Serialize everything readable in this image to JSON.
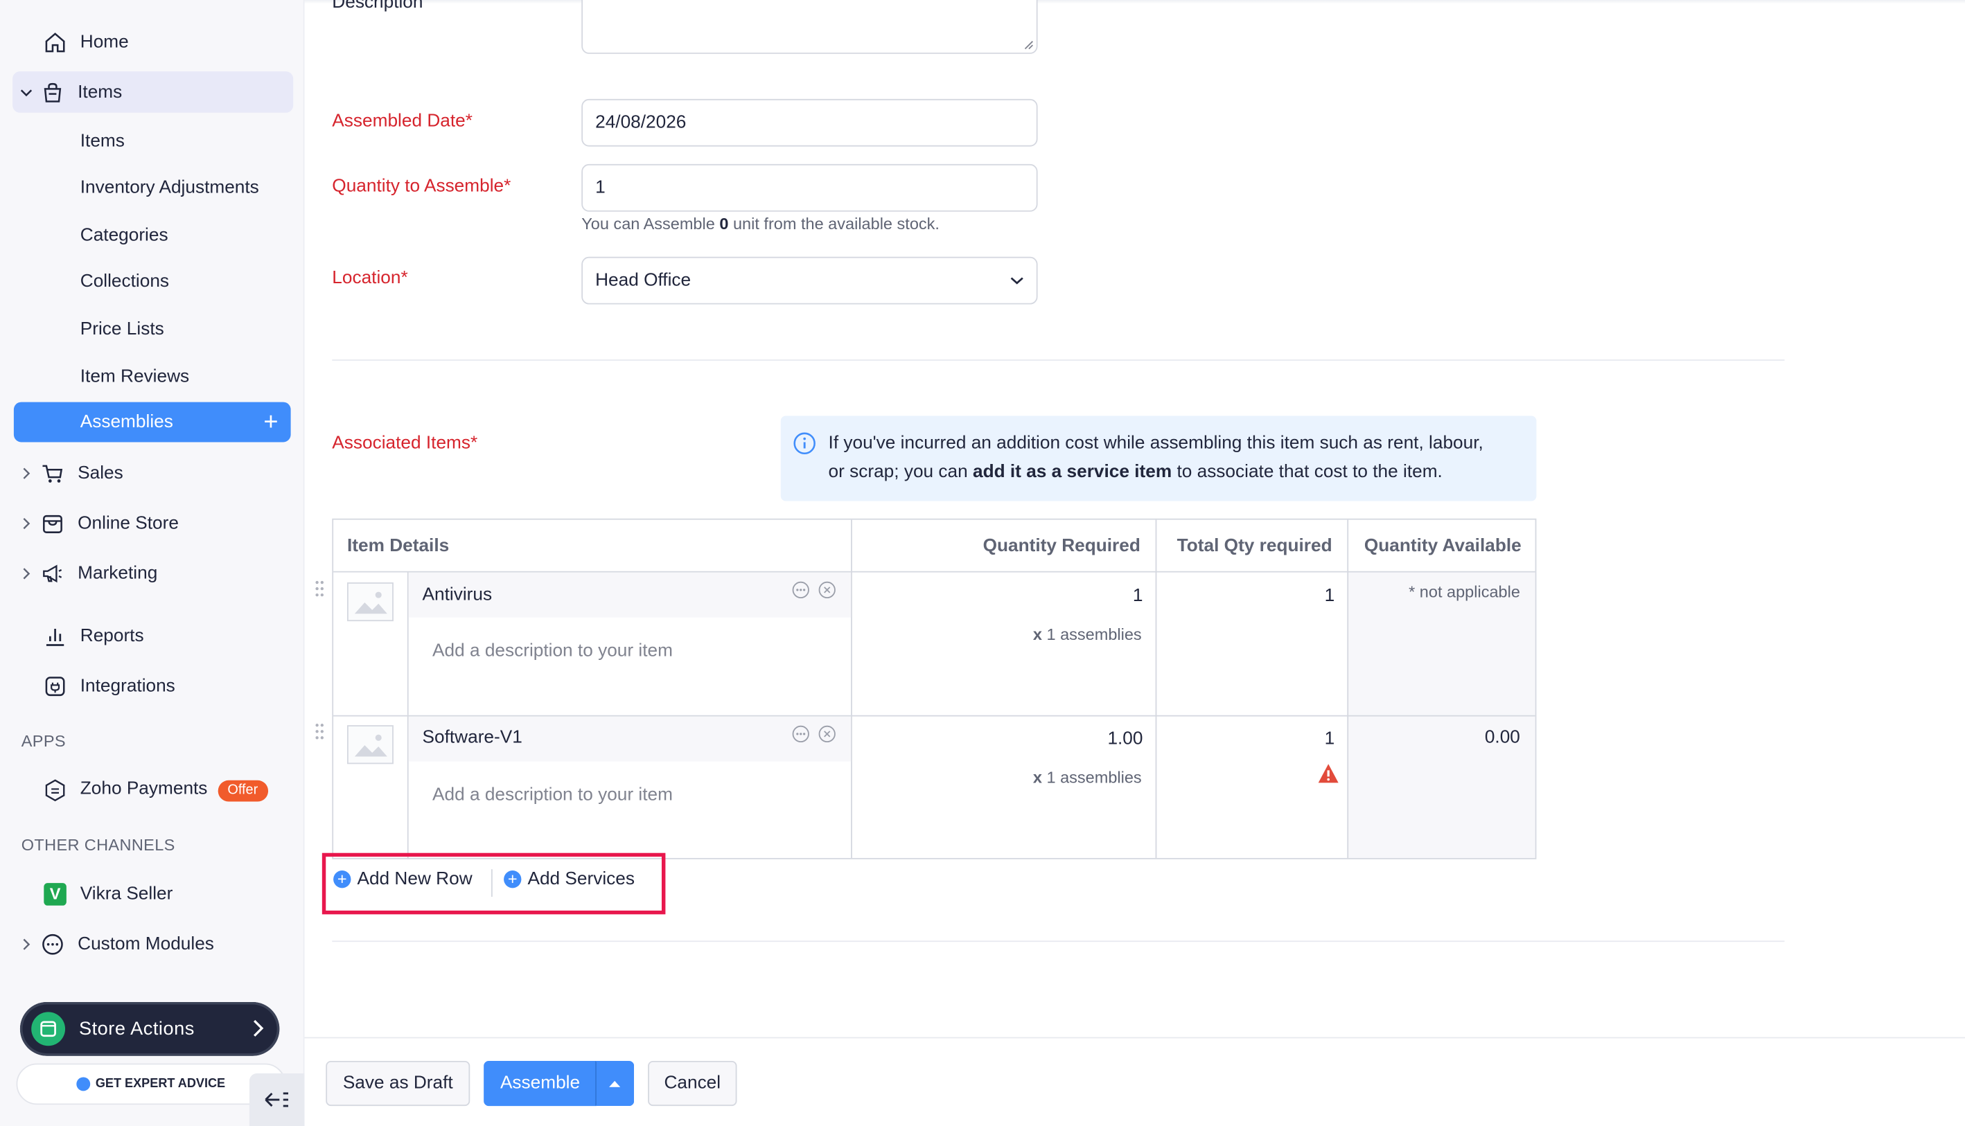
{
  "sidebar": {
    "home": "Home",
    "items_group": "Items",
    "sub_items": [
      "Items",
      "Inventory Adjustments",
      "Categories",
      "Collections",
      "Price Lists",
      "Item Reviews"
    ],
    "assemblies": "Assemblies",
    "sales": "Sales",
    "online_store": "Online Store",
    "marketing": "Marketing",
    "reports": "Reports",
    "integrations": "Integrations",
    "apps_label": "APPS",
    "zoho_payments": "Zoho Payments",
    "offer_badge": "Offer",
    "other_channels_label": "OTHER CHANNELS",
    "vikra_seller": "Vikra Seller",
    "custom_modules": "Custom Modules",
    "store_actions": "Store Actions",
    "expert_advice": "GET EXPERT ADVICE"
  },
  "form": {
    "description_label": "Description",
    "assembled_date_label": "Assembled Date*",
    "assembled_date_value": "24/08/2026",
    "quantity_label": "Quantity to Assemble*",
    "quantity_value": "1",
    "hint_prefix": "You can Assemble ",
    "hint_bold": "0",
    "hint_suffix": " unit from the available stock.",
    "location_label": "Location*",
    "location_value": "Head Office"
  },
  "associated": {
    "label": "Associated Items*",
    "info_line1": "If you've incurred an addition cost while assembling this item such as rent, labour,",
    "info_line2_prefix": "or scrap; you can ",
    "info_line2_bold": "add it as a service item",
    "info_line2_suffix": " to associate that cost to the item."
  },
  "table": {
    "headers": [
      "Item Details",
      "Quantity Required",
      "Total Qty required",
      "Quantity Available"
    ],
    "rows": [
      {
        "name": "Antivirus",
        "description_placeholder": "Add a description to your item",
        "qty_required": "1",
        "assemblies_x": "x",
        "assemblies_text": "1 assemblies",
        "total_qty": "1",
        "available": "* not applicable"
      },
      {
        "name": "Software-V1",
        "description_placeholder": "Add a description to your item",
        "qty_required": "1.00",
        "assemblies_x": "x",
        "assemblies_text": "1 assemblies",
        "total_qty": "1",
        "available": "0.00"
      }
    ]
  },
  "actions": {
    "add_new_row": "Add New Row",
    "add_services": "Add Services"
  },
  "footer": {
    "save_draft": "Save as Draft",
    "assemble": "Assemble",
    "cancel": "Cancel"
  },
  "colors": {
    "accent": "#408dfb",
    "required_label": "#d6242d",
    "highlight_box": "#e8174d",
    "warning": "#e24b3b"
  },
  "icons": [
    "home-icon",
    "items-icon",
    "sales-cart-icon",
    "online-store-icon",
    "marketing-megaphone-icon",
    "reports-icon",
    "integrations-icon",
    "zoho-payments-icon",
    "vikra-icon",
    "custom-modules-icon",
    "store-icon",
    "info-icon",
    "image-placeholder-icon",
    "more-options-icon",
    "remove-icon",
    "warning-icon",
    "drag-handle-icon",
    "chevron-down-icon",
    "collapse-sidebar-icon"
  ]
}
